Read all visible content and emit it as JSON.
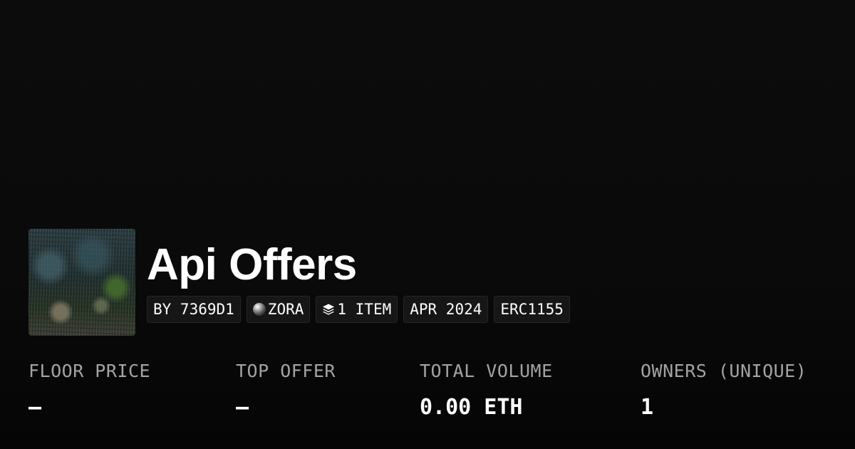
{
  "collection": {
    "title": "Api Offers"
  },
  "tags": {
    "creator": "BY 7369D1",
    "chain": "ZORA",
    "items": "1 ITEM",
    "date": "APR 2024",
    "standard": "ERC1155"
  },
  "stats": {
    "floor_price": {
      "label": "FLOOR PRICE",
      "value": "—"
    },
    "top_offer": {
      "label": "TOP OFFER",
      "value": "—"
    },
    "total_volume": {
      "label": "TOTAL VOLUME",
      "value": "0.00 ETH"
    },
    "owners": {
      "label": "OWNERS (UNIQUE)",
      "value": "1"
    }
  },
  "icons": {
    "chain": "zora-orb-icon",
    "items": "layers-icon"
  },
  "colors": {
    "background": "#0a0a0a",
    "tag_background": "#161616",
    "label_gray": "#a3a3a3",
    "text": "#ffffff"
  }
}
